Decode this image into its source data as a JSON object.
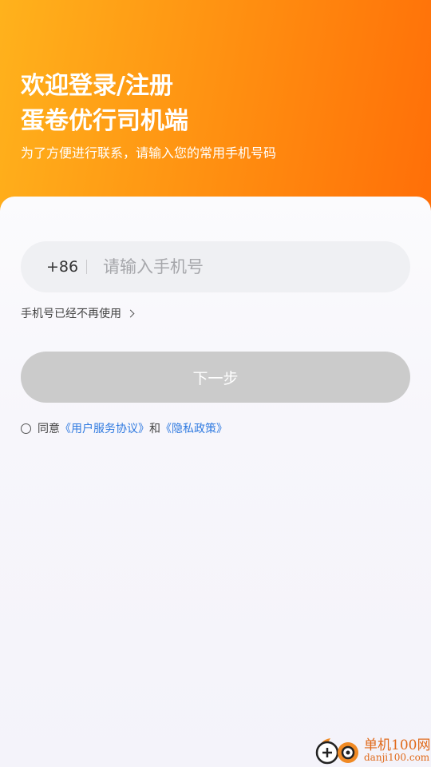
{
  "header": {
    "title_line1": "欢迎登录/注册",
    "title_line2": "蛋卷优行司机端",
    "subtitle": "为了方便进行联系，请输入您的常用手机号码"
  },
  "phone_field": {
    "country_code": "+86",
    "placeholder": "请输入手机号",
    "value": ""
  },
  "unused_link": {
    "label": "手机号已经不再使用"
  },
  "next_button": {
    "label": "下一步",
    "enabled": false
  },
  "agreement": {
    "checked": false,
    "prefix": "同意",
    "terms_link": "《用户服务协议》",
    "conjunction": "和",
    "privacy_link": "《隐私政策》"
  },
  "watermark": {
    "brand": "单机100网",
    "domain": "danji100.com"
  },
  "colors": {
    "header_gradient_start": "#ffb21c",
    "header_gradient_end": "#ff6e08",
    "button_disabled": "#cbcbcb",
    "link": "#2f7ae0"
  },
  "icons": {
    "chevron": "chevron-right-icon",
    "radio": "radio-unchecked-icon"
  }
}
